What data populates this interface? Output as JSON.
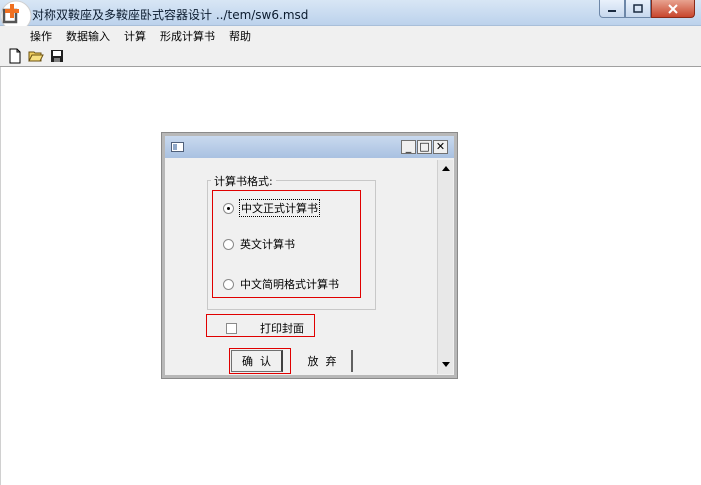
{
  "window": {
    "title": "对称双鞍座及多鞍座卧式容器设计 ../tem/sw6.msd",
    "minimize_label": "—",
    "maximize_label": "□",
    "close_label": "✕"
  },
  "menu": {
    "items": [
      {
        "label": "操作"
      },
      {
        "label": "数据输入"
      },
      {
        "label": "计算"
      },
      {
        "label": "形成计算书"
      },
      {
        "label": "帮助"
      }
    ]
  },
  "toolbar": {
    "buttons": [
      {
        "icon": "new-file-icon"
      },
      {
        "icon": "open-folder-icon"
      },
      {
        "icon": "save-disk-icon"
      }
    ]
  },
  "dialog": {
    "min_label": "_",
    "max_label": "□",
    "close_label": "✕",
    "group_label": "计算书格式:",
    "options": [
      {
        "label": "中文正式计算书",
        "selected": true
      },
      {
        "label": "英文计算书",
        "selected": false
      },
      {
        "label": "中文简明格式计算书",
        "selected": false
      }
    ],
    "print_cover_label": "打印封面",
    "print_cover_checked": false,
    "confirm_label": "确  认",
    "cancel_label": "放  弃"
  },
  "colors": {
    "highlight": "#e00000",
    "title_bar": "#bcd2ec",
    "close_button": "#c8462d"
  }
}
